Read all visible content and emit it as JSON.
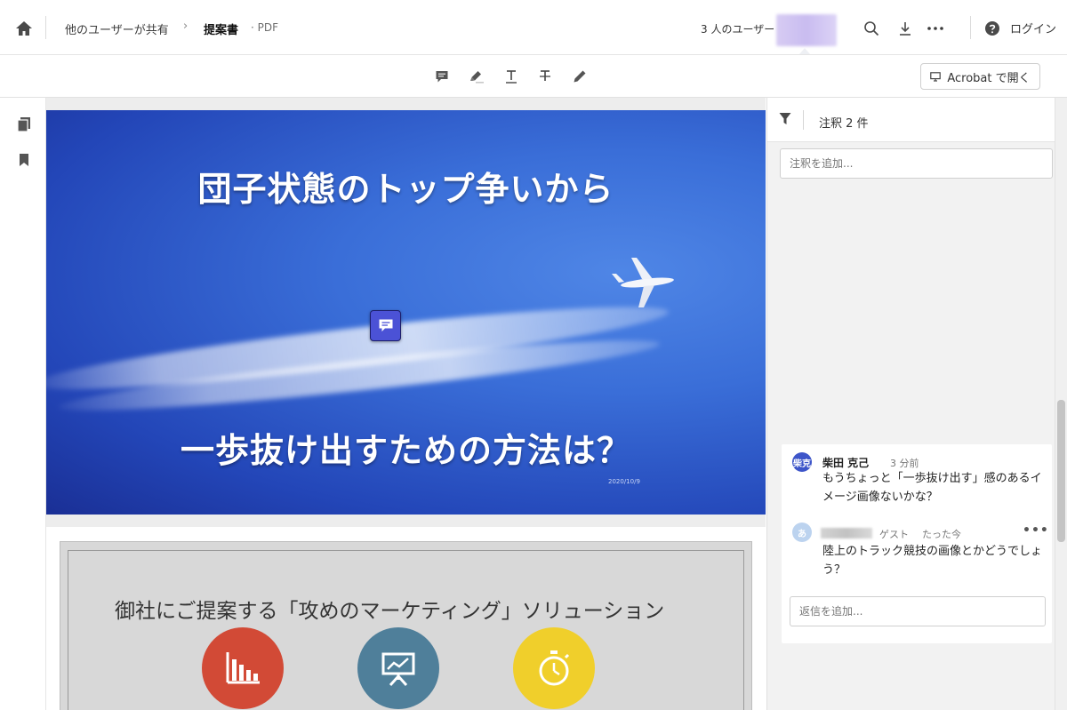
{
  "header": {
    "breadcrumb_shared": "他のユーザーが共有",
    "breadcrumb_sep": "›",
    "doc_name": "提案書",
    "doc_type": "· PDF",
    "users_count": "3 人のユーザー",
    "login": "ログイン"
  },
  "toolbar": {
    "open_in_acrobat": "Acrobat で開く"
  },
  "slide1": {
    "title_line1": "団子状態のトップ争いから",
    "title_line2": "一歩抜け出すための方法は？",
    "date": "2020/10/9"
  },
  "slide2": {
    "title": "御社にご提案する「攻めのマーケティング」ソリューション",
    "circle_colors": [
      "#d24a36",
      "#4f7f9a",
      "#f0cf2b"
    ]
  },
  "panel": {
    "comment_count": "注釈 2 件",
    "add_note_placeholder": "注釈を追加...",
    "comments": [
      {
        "avatar": "柴克",
        "name": "柴田 克己",
        "time": "3 分前",
        "body": "もうちょっと「一歩抜け出す」感のあるイメージ画像ないかな？"
      },
      {
        "avatar": "あ",
        "role": "ゲスト",
        "time": "たった今",
        "body": "陸上のトラック競技の画像とかどうでしょう？",
        "more": "•••"
      }
    ],
    "reply_placeholder": "返信を追加..."
  },
  "colors": {
    "accent": "#4b52d6",
    "avatar1": "#3d55c9",
    "avatar2": "#bcd3ef"
  }
}
